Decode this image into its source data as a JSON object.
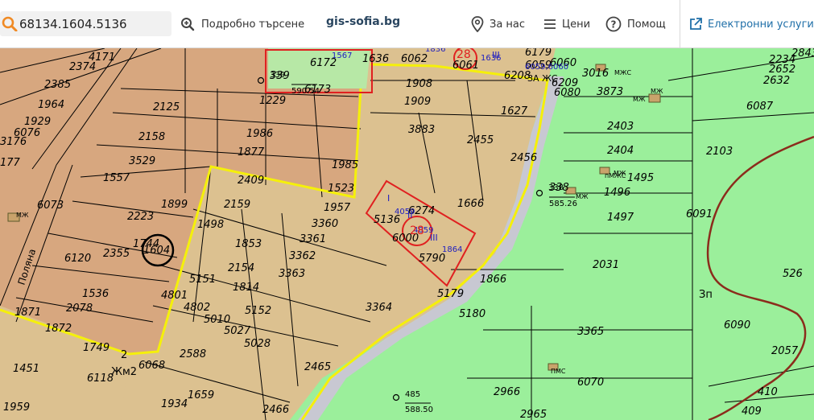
{
  "header": {
    "search_value": "68134.1604.5136",
    "advanced_search": "Подробно търсене",
    "brand": "gis-sofia.bg",
    "nav": [
      {
        "label": "За нас",
        "icon": "location-pin-icon"
      },
      {
        "label": "Цени",
        "icon": "list-icon"
      },
      {
        "label": "Помощ",
        "icon": "help-icon"
      }
    ],
    "eservices": "Електронни услуги",
    "eservices_icon": "external-link-icon"
  },
  "colors": {
    "parcel_brown": "#d7a77f",
    "parcel_tan": "#dcc190",
    "green_zone": "#9bef9b",
    "road_gray": "#c8c8d2",
    "yellow_boundary": "#f5f00a",
    "red_highlight": "#e02020",
    "blue_label": "#2020c0"
  },
  "map": {
    "parcel_labels": [
      "2374",
      "4171",
      "2385",
      "1964",
      "1929",
      "6076",
      "3176",
      "177",
      "2125",
      "2158",
      "1986",
      "1877",
      "3529",
      "1557",
      "1899",
      "6073",
      "2223",
      "1744",
      "1604",
      "2355",
      "6120",
      "1536",
      "2078",
      "1871",
      "1872",
      "1749",
      "1451",
      "6118",
      "1959",
      "1934",
      "1659",
      "2466",
      "2465",
      "2588",
      "6068",
      "5028",
      "5027",
      "5010",
      "4802",
      "5152",
      "1814",
      "5151",
      "4801",
      "2154",
      "3363",
      "3362",
      "1853",
      "3361",
      "1498",
      "2159",
      "2409",
      "3360",
      "1957",
      "1523",
      "1985",
      "1229",
      "6173",
      "6172",
      "339",
      "1636",
      "6062",
      "1908",
      "1909",
      "3883",
      "1627",
      "2455",
      "2456",
      "1666",
      "5136",
      "6274",
      "6000",
      "5790",
      "3364",
      "5179",
      "1866",
      "5180",
      "3365",
      "6070",
      "2966",
      "2965",
      "6059",
      "6060",
      "6061",
      "6179",
      "6208",
      "6209",
      "6080",
      "3873",
      "3016",
      "2403",
      "2404",
      "1495",
      "1496",
      "1497",
      "2031",
      "2103",
      "2234",
      "2843",
      "2652",
      "2632",
      "6087",
      "6091",
      "526",
      "6090",
      "2057",
      "410",
      "409",
      "338"
    ],
    "blue_labels": [
      "1567",
      "1836",
      "1636",
      "4059",
      "4059",
      "1864",
      "6059,6060"
    ],
    "red_labels": [
      "28",
      "28",
      "28"
    ],
    "building_labels": [
      "МЖ",
      "МЖС",
      "МЖ",
      "пМЖС",
      "МЖ",
      "МЖ",
      "ПМС",
      "МЖ"
    ],
    "zone_labels": [
      "Жм2",
      "2",
      "Зп",
      "III",
      "II",
      "I",
      "III",
      "ЗА ЖС"
    ],
    "road_label": "Полянa",
    "elevation_points": [
      {
        "name": "339",
        "value": "590.54"
      },
      {
        "name": "338",
        "value": "585.26"
      },
      {
        "name": "485",
        "value": "588.50"
      }
    ]
  }
}
